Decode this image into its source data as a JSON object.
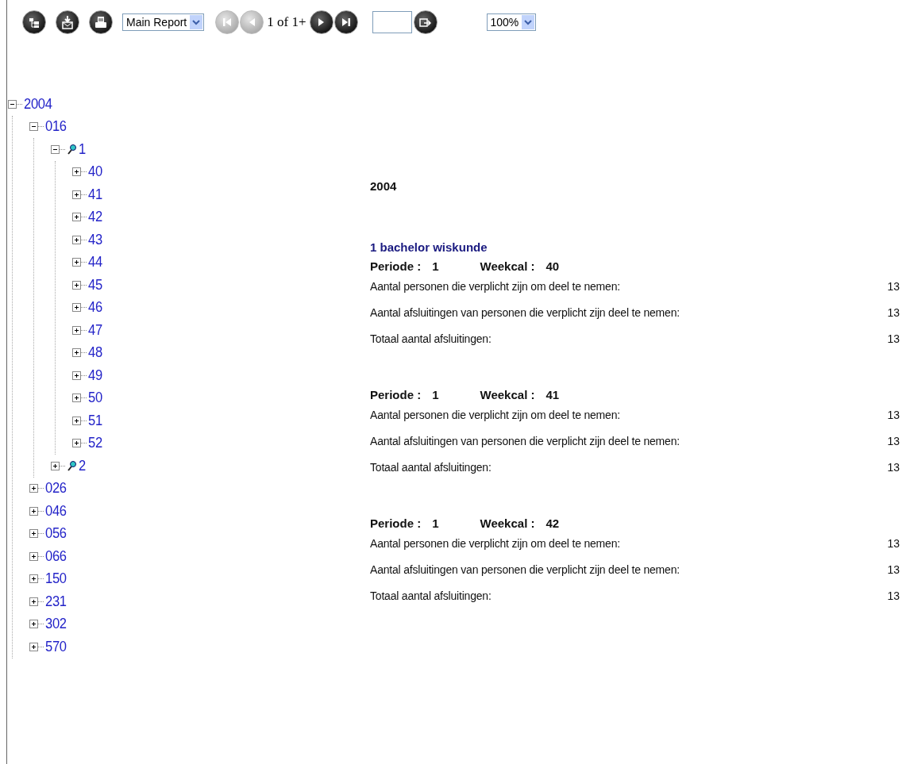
{
  "toolbar": {
    "buttons": [
      {
        "kind": "tree"
      },
      {
        "kind": "export"
      },
      {
        "kind": "print"
      }
    ],
    "report_select": {
      "value": "Main Report"
    },
    "nav_back": [
      {
        "kind": "first",
        "disabled": true
      },
      {
        "kind": "previous",
        "disabled": true
      }
    ],
    "page_text": "1 of 1+",
    "nav_forward": [
      {
        "kind": "next",
        "disabled": false
      },
      {
        "kind": "last",
        "disabled": false
      }
    ],
    "zoom_select": {
      "value": "100%"
    }
  },
  "tree": [
    {
      "label": "2004",
      "expanded": true,
      "magnifier": false,
      "children": [
        {
          "label": "016",
          "expanded": true,
          "magnifier": false,
          "children": [
            {
              "label": "1",
              "expanded": true,
              "magnifier": true,
              "children": [
                {
                  "label": "40",
                  "expanded": false,
                  "magnifier": false
                },
                {
                  "label": "41",
                  "expanded": false,
                  "magnifier": false
                },
                {
                  "label": "42",
                  "expanded": false,
                  "magnifier": false
                },
                {
                  "label": "43",
                  "expanded": false,
                  "magnifier": false
                },
                {
                  "label": "44",
                  "expanded": false,
                  "magnifier": false
                },
                {
                  "label": "45",
                  "expanded": false,
                  "magnifier": false
                },
                {
                  "label": "46",
                  "expanded": false,
                  "magnifier": false
                },
                {
                  "label": "47",
                  "expanded": false,
                  "magnifier": false
                },
                {
                  "label": "48",
                  "expanded": false,
                  "magnifier": false
                },
                {
                  "label": "49",
                  "expanded": false,
                  "magnifier": false
                },
                {
                  "label": "50",
                  "expanded": false,
                  "magnifier": false
                },
                {
                  "label": "51",
                  "expanded": false,
                  "magnifier": false
                },
                {
                  "label": "52",
                  "expanded": false,
                  "magnifier": false
                }
              ]
            },
            {
              "label": "2",
              "expanded": false,
              "magnifier": true
            }
          ]
        },
        {
          "label": "026",
          "expanded": false,
          "magnifier": false
        },
        {
          "label": "046",
          "expanded": false,
          "magnifier": false
        },
        {
          "label": "056",
          "expanded": false,
          "magnifier": false
        },
        {
          "label": "066",
          "expanded": false,
          "magnifier": false
        },
        {
          "label": "150",
          "expanded": false,
          "magnifier": false
        },
        {
          "label": "231",
          "expanded": false,
          "magnifier": false
        },
        {
          "label": "302",
          "expanded": false,
          "magnifier": false
        },
        {
          "label": "570",
          "expanded": false,
          "magnifier": false
        }
      ]
    }
  ],
  "report": {
    "year": "2004",
    "group_title": "1 bachelor wiskunde",
    "sections": [
      {
        "periode_label": "Periode :",
        "periode": "1",
        "weekcal_label": "Weekcal :",
        "weekcal": "40",
        "rows": [
          {
            "label": "Aantal personen die verplicht zijn om deel te nemen:",
            "value": "13"
          },
          {
            "label": "Aantal afsluitingen van personen die verplicht zijn deel te nemen:",
            "value": "13"
          },
          {
            "label": "Totaal aantal afsluitingen:",
            "value": "13"
          }
        ]
      },
      {
        "periode_label": "Periode :",
        "periode": "1",
        "weekcal_label": "Weekcal :",
        "weekcal": "41",
        "rows": [
          {
            "label": "Aantal personen die verplicht zijn om deel te nemen:",
            "value": "13"
          },
          {
            "label": "Aantal afsluitingen van personen die verplicht zijn deel te nemen:",
            "value": "13"
          },
          {
            "label": "Totaal aantal afsluitingen:",
            "value": "13"
          }
        ]
      },
      {
        "periode_label": "Periode :",
        "periode": "1",
        "weekcal_label": "Weekcal :",
        "weekcal": "42",
        "rows": [
          {
            "label": "Aantal personen die verplicht zijn om deel te nemen:",
            "value": "13"
          },
          {
            "label": "Aantal afsluitingen van personen die verplicht zijn deel te nemen:",
            "value": "13"
          },
          {
            "label": "Totaal aantal afsluitingen:",
            "value": "13"
          }
        ]
      }
    ]
  }
}
